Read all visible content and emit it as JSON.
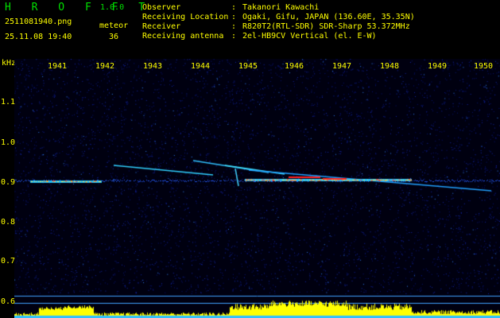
{
  "header": {
    "app_title": "H R O F F T",
    "app_version": "1.0.0",
    "file_name": "2511081940.png",
    "date_time": "25.11.08 19:40",
    "meteor_label": "meteor",
    "meteor_count": "36",
    "info": [
      {
        "key": "Observer",
        "value": "Takanori Kawachi"
      },
      {
        "key": "Receiving Location",
        "value": "Ogaki, Gifu, JAPAN (136.60E, 35.35N)"
      },
      {
        "key": "Receiver",
        "value": "R820T2(RTL-SDR) SDR-Sharp 53.372MHz"
      },
      {
        "key": "Receiving antenna",
        "value": "2el-HB9CV Vertical (el. E-W)"
      }
    ],
    "separator": ":"
  },
  "axes": {
    "y_unit": "kHz",
    "x_ticks": [
      "1941",
      "1942",
      "1943",
      "1944",
      "1945",
      "1946",
      "1947",
      "1948",
      "1949",
      "1950"
    ],
    "y_ticks": [
      "1.1",
      "1.0",
      "0.9",
      "0.8",
      "0.7",
      "0.6"
    ]
  },
  "colors": {
    "background": "#000000",
    "label": "#ffff00",
    "title": "#00e000",
    "noise": "#1020c0",
    "signal_mid": "#20d0ff",
    "signal_high": "#ff3030",
    "level_bar": "#ffff00",
    "baseline": "#40c0ff"
  }
}
